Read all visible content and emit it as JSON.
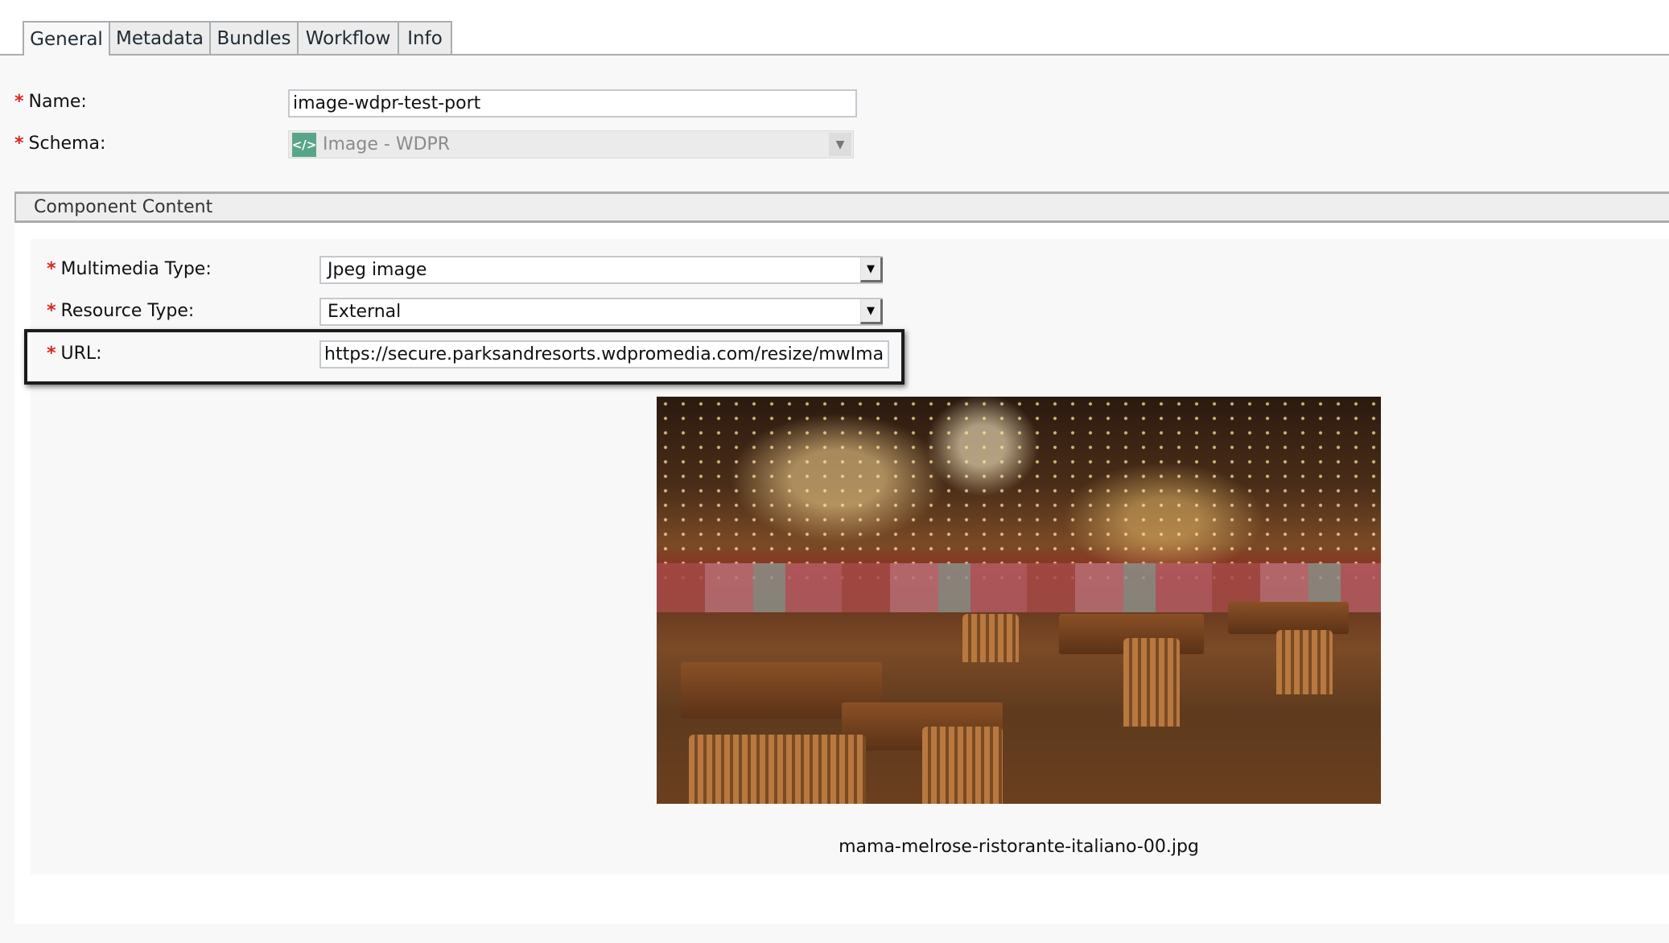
{
  "tabs": [
    {
      "label": "General",
      "active": true
    },
    {
      "label": "Metadata",
      "active": false
    },
    {
      "label": "Bundles",
      "active": false
    },
    {
      "label": "Workflow",
      "active": false
    },
    {
      "label": "Info",
      "active": false
    }
  ],
  "general": {
    "required_marker": "*",
    "name_label": "Name:",
    "name_value": "image-wdpr-test-port",
    "schema_label": "Schema:",
    "schema_value": "Image - WDPR",
    "schema_icon": "code-brackets-icon",
    "schema_icon_glyph": "</>",
    "schema_disabled": true
  },
  "component_content": {
    "title": "Component Content",
    "multimedia_type_label": "Multimedia Type:",
    "multimedia_type_value": "Jpeg image",
    "resource_type_label": "Resource Type:",
    "resource_type_value": "External",
    "url_label": "URL:",
    "url_value": "https://secure.parksandresorts.wdpromedia.com/resize/mwImage",
    "url_highlighted": true,
    "preview_caption": "mama-melrose-ristorante-italiano-00.jpg",
    "preview_alt": "Restaurant interior with wooden tables, chairs and string lights"
  },
  "colors": {
    "required": "#d9261c",
    "schema_icon_bg": "#5aa58a",
    "highlight_border": "#1b1b1b",
    "tab_border": "#a9adb1"
  },
  "glyphs": {
    "dropdown_arrow": "▼"
  }
}
